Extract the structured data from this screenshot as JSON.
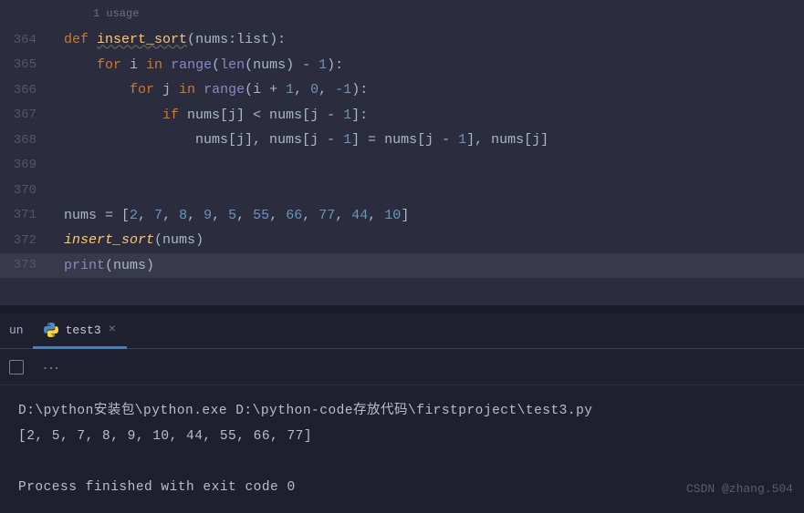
{
  "editor": {
    "usage_hint": "1 usage",
    "lines": [
      {
        "num": "364",
        "tokens": [
          {
            "t": "def ",
            "c": "kw"
          },
          {
            "t": "insert_sort",
            "c": "fn-def"
          },
          {
            "t": "(",
            "c": "punct"
          },
          {
            "t": "nums",
            "c": "param"
          },
          {
            "t": ":",
            "c": "punct"
          },
          {
            "t": "list",
            "c": "type"
          },
          {
            "t": "):",
            "c": "punct"
          }
        ]
      },
      {
        "num": "365",
        "tokens": [
          {
            "t": "    ",
            "c": ""
          },
          {
            "t": "for ",
            "c": "kw"
          },
          {
            "t": "i ",
            "c": "var"
          },
          {
            "t": "in ",
            "c": "kw"
          },
          {
            "t": "range",
            "c": "builtin"
          },
          {
            "t": "(",
            "c": "punct"
          },
          {
            "t": "len",
            "c": "builtin"
          },
          {
            "t": "(",
            "c": "punct"
          },
          {
            "t": "nums",
            "c": "var"
          },
          {
            "t": ") - ",
            "c": "punct"
          },
          {
            "t": "1",
            "c": "num"
          },
          {
            "t": "):",
            "c": "punct"
          }
        ]
      },
      {
        "num": "366",
        "tokens": [
          {
            "t": "        ",
            "c": ""
          },
          {
            "t": "for ",
            "c": "kw"
          },
          {
            "t": "j ",
            "c": "var"
          },
          {
            "t": "in ",
            "c": "kw"
          },
          {
            "t": "range",
            "c": "builtin"
          },
          {
            "t": "(",
            "c": "punct"
          },
          {
            "t": "i + ",
            "c": "var"
          },
          {
            "t": "1",
            "c": "num"
          },
          {
            "t": ", ",
            "c": "punct"
          },
          {
            "t": "0",
            "c": "num"
          },
          {
            "t": ", ",
            "c": "punct"
          },
          {
            "t": "-1",
            "c": "num"
          },
          {
            "t": "):",
            "c": "punct"
          }
        ]
      },
      {
        "num": "367",
        "tokens": [
          {
            "t": "            ",
            "c": ""
          },
          {
            "t": "if ",
            "c": "kw"
          },
          {
            "t": "nums[j] < nums[j - ",
            "c": "var"
          },
          {
            "t": "1",
            "c": "num"
          },
          {
            "t": "]:",
            "c": "punct"
          }
        ]
      },
      {
        "num": "368",
        "tokens": [
          {
            "t": "                ",
            "c": ""
          },
          {
            "t": "nums[j], nums[j - ",
            "c": "var"
          },
          {
            "t": "1",
            "c": "num"
          },
          {
            "t": "] = nums[j - ",
            "c": "var"
          },
          {
            "t": "1",
            "c": "num"
          },
          {
            "t": "], nums[j]",
            "c": "var"
          }
        ]
      },
      {
        "num": "369",
        "tokens": []
      },
      {
        "num": "370",
        "tokens": []
      },
      {
        "num": "371",
        "tokens": [
          {
            "t": "nums = [",
            "c": "var"
          },
          {
            "t": "2",
            "c": "num"
          },
          {
            "t": ", ",
            "c": "punct"
          },
          {
            "t": "7",
            "c": "num"
          },
          {
            "t": ", ",
            "c": "punct"
          },
          {
            "t": "8",
            "c": "num"
          },
          {
            "t": ", ",
            "c": "punct"
          },
          {
            "t": "9",
            "c": "num"
          },
          {
            "t": ", ",
            "c": "punct"
          },
          {
            "t": "5",
            "c": "num"
          },
          {
            "t": ", ",
            "c": "punct"
          },
          {
            "t": "55",
            "c": "num"
          },
          {
            "t": ", ",
            "c": "punct"
          },
          {
            "t": "66",
            "c": "num"
          },
          {
            "t": ", ",
            "c": "punct"
          },
          {
            "t": "77",
            "c": "num"
          },
          {
            "t": ", ",
            "c": "punct"
          },
          {
            "t": "44",
            "c": "num"
          },
          {
            "t": ", ",
            "c": "punct"
          },
          {
            "t": "10",
            "c": "num"
          },
          {
            "t": "]",
            "c": "punct"
          }
        ]
      },
      {
        "num": "372",
        "tokens": [
          {
            "t": "insert_sort",
            "c": "fn"
          },
          {
            "t": "(",
            "c": "punct"
          },
          {
            "t": "nums",
            "c": "var"
          },
          {
            "t": ")",
            "c": "punct"
          }
        ]
      },
      {
        "num": "373",
        "highlighted": true,
        "tokens": [
          {
            "t": "print",
            "c": "builtin"
          },
          {
            "t": "(",
            "c": "punct"
          },
          {
            "t": "nums",
            "c": "var"
          },
          {
            "t": ")",
            "c": "punct"
          }
        ]
      }
    ]
  },
  "run_panel": {
    "run_label": "un",
    "tab_name": "test3",
    "output_lines": [
      "D:\\python安装包\\python.exe D:\\python-code存放代码\\firstproject\\test3.py",
      "[2, 5, 7, 8, 9, 10, 44, 55, 66, 77]",
      "",
      "Process finished with exit code 0"
    ]
  },
  "watermark": "CSDN @zhang.504"
}
